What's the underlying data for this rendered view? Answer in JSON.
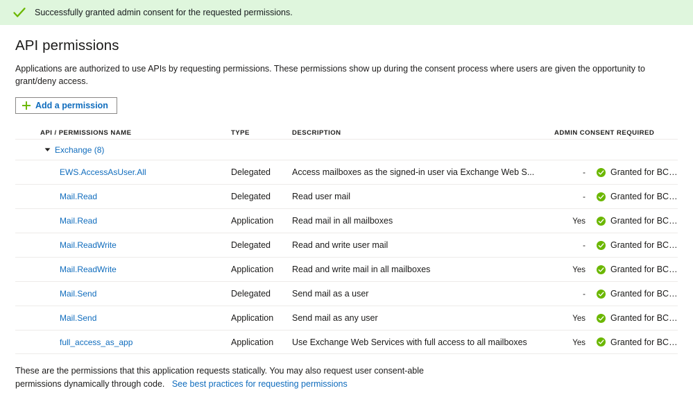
{
  "banner": {
    "icon": "check-icon",
    "message": "Successfully granted admin consent for the requested permissions.",
    "background_color": "#dff6dd",
    "icon_color": "#6bb700"
  },
  "page": {
    "title": "API permissions",
    "description": "Applications are authorized to use APIs by requesting permissions. These permissions show up during the consent process where users are given the opportunity to grant/deny access."
  },
  "toolbar": {
    "add_permission_label": "Add a permission",
    "add_permission_icon": "plus-icon",
    "plus_color": "#6bb700",
    "link_color": "#0f6cbd"
  },
  "table": {
    "headers": {
      "name": "API / PERMISSIONS NAME",
      "type": "TYPE",
      "description": "DESCRIPTION",
      "admin_consent_required": "ADMIN CONSENT REQUIRED",
      "status": ""
    },
    "group": {
      "label": "Exchange (8)",
      "expanded": true,
      "chevron_icon": "chevron-down-icon"
    },
    "rows": [
      {
        "name": "EWS.AccessAsUser.All",
        "type": "Delegated",
        "description": "Access mailboxes as the signed-in user via Exchange Web S...",
        "admin_consent_required": "-",
        "status": "Granted for BCE Dem...",
        "status_icon": "granted-check-icon"
      },
      {
        "name": "Mail.Read",
        "type": "Delegated",
        "description": "Read user mail",
        "admin_consent_required": "-",
        "status": "Granted for BCE Dem...",
        "status_icon": "granted-check-icon"
      },
      {
        "name": "Mail.Read",
        "type": "Application",
        "description": "Read mail in all mailboxes",
        "admin_consent_required": "Yes",
        "status": "Granted for BCE Dem...",
        "status_icon": "granted-check-icon"
      },
      {
        "name": "Mail.ReadWrite",
        "type": "Delegated",
        "description": "Read and write user mail",
        "admin_consent_required": "-",
        "status": "Granted for BCE Dem...",
        "status_icon": "granted-check-icon"
      },
      {
        "name": "Mail.ReadWrite",
        "type": "Application",
        "description": "Read and write mail in all mailboxes",
        "admin_consent_required": "Yes",
        "status": "Granted for BCE Dem...",
        "status_icon": "granted-check-icon"
      },
      {
        "name": "Mail.Send",
        "type": "Delegated",
        "description": "Send mail as a user",
        "admin_consent_required": "-",
        "status": "Granted for BCE Dem...",
        "status_icon": "granted-check-icon"
      },
      {
        "name": "Mail.Send",
        "type": "Application",
        "description": "Send mail as any user",
        "admin_consent_required": "Yes",
        "status": "Granted for BCE Dem...",
        "status_icon": "granted-check-icon"
      },
      {
        "name": "full_access_as_app",
        "type": "Application",
        "description": "Use Exchange Web Services with full access to all mailboxes",
        "admin_consent_required": "Yes",
        "status": "Granted for BCE Dem...",
        "status_icon": "granted-check-icon"
      }
    ]
  },
  "footer": {
    "text": "These are the permissions that this application requests statically. You may also request user consent-able permissions dynamically through code.",
    "link": "See best practices for requesting permissions"
  }
}
